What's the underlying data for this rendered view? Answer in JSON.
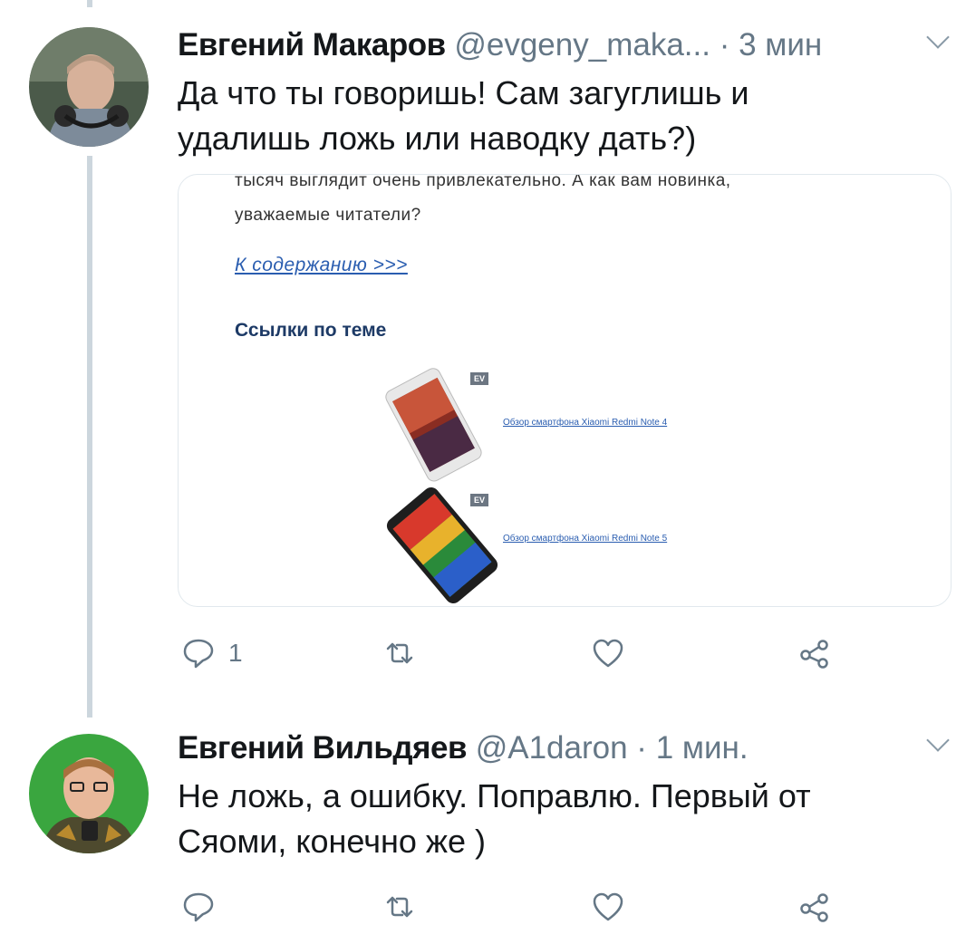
{
  "tweets": [
    {
      "name": "Евгений Макаров",
      "handle": "@evgeny_maka...",
      "separator": "·",
      "time": "3 мин",
      "text_line1": "Да что ты говоришь! Сам загуглишь и",
      "text_line2": "удалишь ложь или наводку дать?)",
      "card": {
        "line1": "тысяч выглядит очень привлекательно. А как вам новинка,",
        "line2": "уважаемые читатели?",
        "toc_link": "К содержанию >>>",
        "related_heading": "Ссылки по теме",
        "related": [
          {
            "badge": "EV",
            "title": "Обзор смартфона Xiaomi Redmi Note 4"
          },
          {
            "badge": "EV",
            "title": "Обзор смартфона Xiaomi Redmi Note 5"
          }
        ]
      },
      "reply_count": "1"
    },
    {
      "name": "Евгений Вильдяев",
      "handle": "@A1daron",
      "separator": "·",
      "time": "1 мин.",
      "text_line1": "Не ложь, а ошибку. Поправлю. Первый от",
      "text_line2": "Сяоми, конечно же )"
    }
  ],
  "icons": [
    "reply-icon",
    "retweet-icon",
    "like-icon",
    "share-icon",
    "chevron-down-icon"
  ],
  "colors": {
    "thread_line": "#ccd6dd",
    "muted": "#657786",
    "text": "#14171a",
    "link": "#2a5db0"
  }
}
